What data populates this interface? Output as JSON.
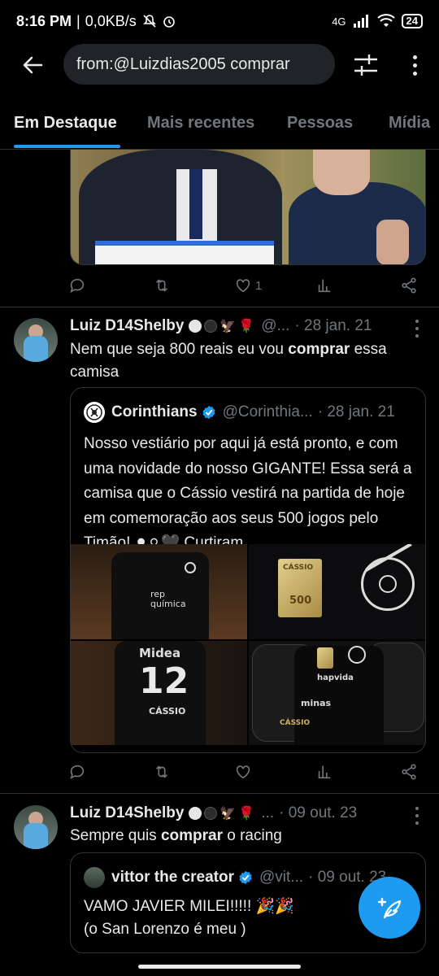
{
  "status_bar": {
    "time": "8:16 PM",
    "net_speed": "0,0KB/s",
    "network": "4G",
    "battery": "24"
  },
  "search": {
    "query": "from:@Luizdias2005 comprar"
  },
  "tabs": [
    {
      "label": "Em Destaque",
      "active": true
    },
    {
      "label": "Mais recentes",
      "active": false
    },
    {
      "label": "Pessoas",
      "active": false
    },
    {
      "label": "Mídia",
      "active": false
    }
  ],
  "tweet0": {
    "likes": "1"
  },
  "tweet1": {
    "name": "Luiz D14Shelby",
    "handle": "@...",
    "date": "· 28 jan. 21",
    "text_before": "Nem que seja 800 reais eu vou ",
    "text_bold": "comprar",
    "text_after": " essa camisa",
    "quote": {
      "name": "Corinthians",
      "handle": "@Corinthia...",
      "date": "· 28 jan. 21",
      "text": "Nosso vestiário por aqui já está pronto, e com uma novidade do nosso GIGANTE! Essa será a camisa que o Cássio vestirá na partida de hoje em comemoração aos seus 500 jogos pelo Timão! ⚫⚪🖤 Curtiram, ...",
      "image_texts": {
        "g1_brand": "rep química",
        "g2_patch_name": "CÁSSIO",
        "g2_patch_num": "500",
        "g3_brand": "Midea",
        "g3_number": "12",
        "g3_name": "CÁSSIO",
        "g4_sponsor": "hapvida",
        "g4_brand": "minas",
        "g4_name": "CÁSSIO"
      }
    }
  },
  "tweet2": {
    "name": "Luiz D14Shelby",
    "handle": "...",
    "date": "· 09 out. 23",
    "text_before": "Sempre quis ",
    "text_bold": "comprar",
    "text_after": " o racing",
    "quote": {
      "name": "vittor the creator",
      "handle": "@vit...",
      "date": "· 09 out. 23",
      "line1": "VAMO JAVIER MILEI!!!!! 🎉🎉",
      "line2": "(o San Lorenzo é meu )"
    }
  },
  "icons": [
    "back-arrow-icon",
    "filter-icon",
    "more-vertical-icon",
    "reply-icon",
    "retweet-icon",
    "like-icon",
    "views-icon",
    "share-icon",
    "verified-icon",
    "compose-icon"
  ],
  "colors": {
    "accent": "#1d9bf0",
    "background": "#000000",
    "muted_text": "#71767b",
    "divider": "#2f3336"
  }
}
